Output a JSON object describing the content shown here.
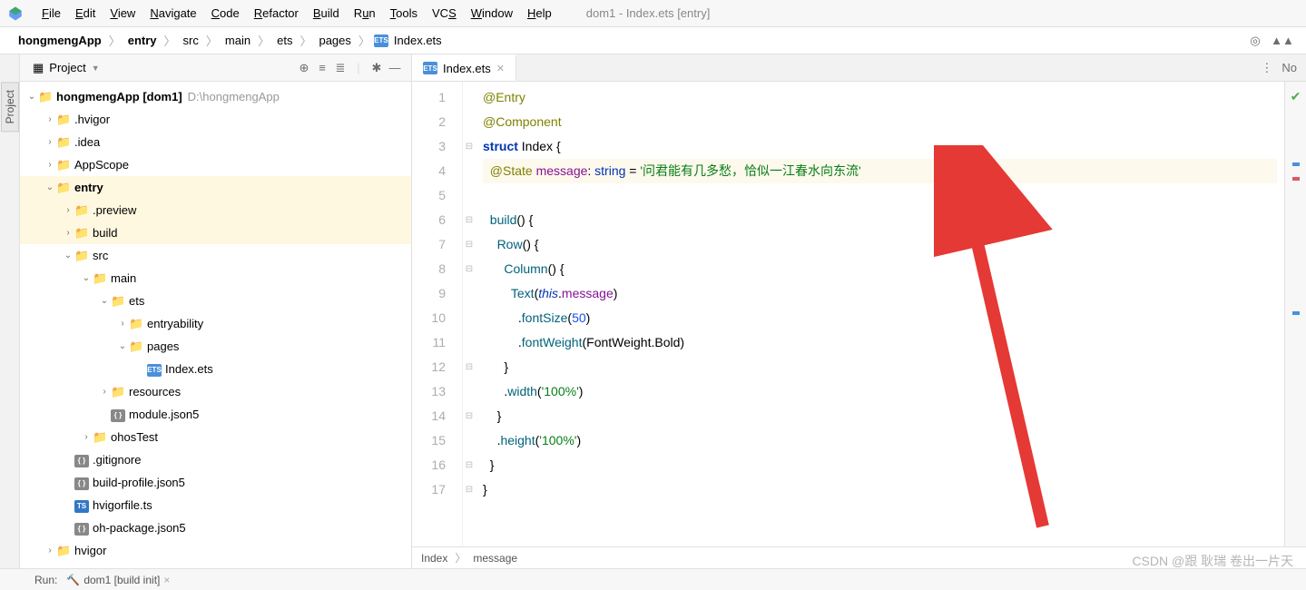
{
  "window_title": "dom1 - Index.ets [entry]",
  "menus": [
    "File",
    "Edit",
    "View",
    "Navigate",
    "Code",
    "Refactor",
    "Build",
    "Run",
    "Tools",
    "VCS",
    "Window",
    "Help"
  ],
  "breadcrumbs": {
    "items": [
      "hongmengApp",
      "entry",
      "src",
      "main",
      "ets",
      "pages",
      "Index.ets"
    ]
  },
  "project_panel": {
    "selector": "Project",
    "tree": [
      {
        "depth": 0,
        "tw": "v",
        "icon": "folder-b",
        "label": "hongmengApp [dom1]",
        "bold": true,
        "path": "D:\\hongmengApp"
      },
      {
        "depth": 1,
        "tw": ">",
        "icon": "folder",
        "label": ".hvigor"
      },
      {
        "depth": 1,
        "tw": ">",
        "icon": "folder",
        "label": ".idea"
      },
      {
        "depth": 1,
        "tw": ">",
        "icon": "folder",
        "label": "AppScope"
      },
      {
        "depth": 1,
        "tw": "v",
        "icon": "folder-b",
        "label": "entry",
        "bold": true,
        "sel": true
      },
      {
        "depth": 2,
        "tw": ">",
        "icon": "folder-o",
        "label": ".preview",
        "sel": true
      },
      {
        "depth": 2,
        "tw": ">",
        "icon": "folder-o",
        "label": "build",
        "sel": true
      },
      {
        "depth": 2,
        "tw": "v",
        "icon": "folder",
        "label": "src"
      },
      {
        "depth": 3,
        "tw": "v",
        "icon": "folder",
        "label": "main"
      },
      {
        "depth": 4,
        "tw": "v",
        "icon": "folder",
        "label": "ets"
      },
      {
        "depth": 5,
        "tw": ">",
        "icon": "folder",
        "label": "entryability"
      },
      {
        "depth": 5,
        "tw": "v",
        "icon": "folder",
        "label": "pages"
      },
      {
        "depth": 6,
        "tw": "",
        "icon": "ets",
        "label": "Index.ets"
      },
      {
        "depth": 4,
        "tw": ">",
        "icon": "folder",
        "label": "resources"
      },
      {
        "depth": 4,
        "tw": "",
        "icon": "json",
        "label": "module.json5"
      },
      {
        "depth": 3,
        "tw": ">",
        "icon": "folder",
        "label": "ohosTest"
      },
      {
        "depth": 2,
        "tw": "",
        "icon": "json",
        "label": ".gitignore"
      },
      {
        "depth": 2,
        "tw": "",
        "icon": "json",
        "label": "build-profile.json5"
      },
      {
        "depth": 2,
        "tw": "",
        "icon": "ts",
        "label": "hvigorfile.ts"
      },
      {
        "depth": 2,
        "tw": "",
        "icon": "json",
        "label": "oh-package.json5"
      },
      {
        "depth": 1,
        "tw": ">",
        "icon": "folder",
        "label": "hvigor"
      }
    ]
  },
  "editor": {
    "tab_label": "Index.ets",
    "right_label": "No",
    "lines": [
      1,
      2,
      3,
      4,
      5,
      6,
      7,
      8,
      9,
      10,
      11,
      12,
      13,
      14,
      15,
      16,
      17
    ],
    "code": {
      "l1": "@Entry",
      "l2": "@Component",
      "l3_kw": "struct",
      "l3_name": "Index",
      "l4_anno": "@State",
      "l4_prop": "message",
      "l4_type": "string",
      "l4_str": "'问君能有几多愁，恰似一江春水向东流'",
      "l6_fn": "build",
      "l7_fn": "Row",
      "l8_fn": "Column",
      "l9_fn": "Text",
      "l9_this": "this",
      "l9_prop": "message",
      "l10_fn": "fontSize",
      "l10_num": "50",
      "l11_fn": "fontWeight",
      "l11_enum": "FontWeight",
      "l11_val": "Bold",
      "l13_fn": "width",
      "l13_str": "'100%'",
      "l15_fn": "height",
      "l15_str": "'100%'"
    },
    "crumbs": [
      "Index",
      "message"
    ]
  },
  "footer": {
    "run": "Run:",
    "task": "dom1 [build init]"
  },
  "sidebar_tab": "Project",
  "watermark": "CSDN @跟 耿瑞 卷出一片天"
}
